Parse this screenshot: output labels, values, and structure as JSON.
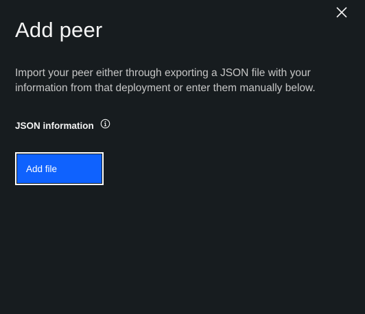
{
  "panel": {
    "title": "Add peer",
    "description": "Import your peer either through exporting a JSON file with your information from that deployment or enter them manually below.",
    "section_label": "JSON information",
    "add_file_label": "Add file"
  },
  "icons": {
    "close": "close-icon",
    "info": "info-icon"
  },
  "colors": {
    "background": "#171c1f",
    "primary_button": "#0f62fe",
    "text_primary": "#f4f4f4",
    "text_secondary": "#c6c6c6"
  }
}
